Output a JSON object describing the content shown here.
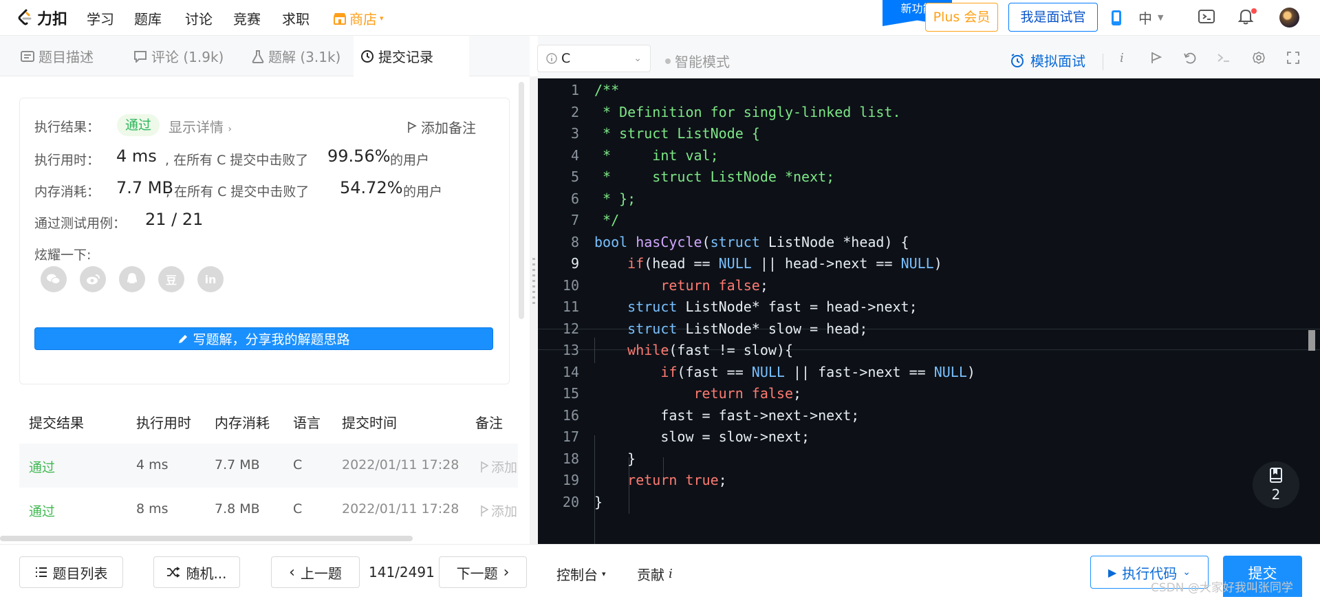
{
  "brand": {
    "name": "力扣"
  },
  "nav": {
    "learn": "学习",
    "problems": "题库",
    "discuss": "讨论",
    "contest": "竞赛",
    "jobs": "求职",
    "store": "商店",
    "new_feature": "新功能",
    "plus": "Plus 会员",
    "interviewer": "我是面试官",
    "language": "中"
  },
  "tabs": [
    {
      "label": "题目描述"
    },
    {
      "label": "评论 (1.9k)"
    },
    {
      "label": "题解 (3.1k)"
    },
    {
      "label": "提交记录"
    }
  ],
  "result": {
    "status_label": "执行结果：",
    "status": "通过",
    "show_detail": "显示详情",
    "add_note": "添加备注",
    "runtime_label": "执行用时：",
    "runtime": "4 ms",
    "runtime_mid": ", 在所有 C 提交中击败了",
    "runtime_pct": "99.56%",
    "runtime_suffix": "的用户",
    "memory_label": "内存消耗：",
    "memory": "7.7 MB",
    "memory_mid": ", 在所有 C 提交中击败了",
    "memory_pct": "54.72%",
    "memory_suffix": "的用户",
    "cases_label": "通过测试用例：",
    "cases": "21 / 21",
    "share_label": "炫耀一下:",
    "share_icons": [
      "wechat-icon",
      "weibo-icon",
      "qq-icon",
      "douban-icon",
      "linkedin-icon"
    ],
    "douban_glyph": "豆",
    "linkedin_glyph": "in",
    "write_solution": "写题解，分享我的解题思路"
  },
  "history": {
    "headers": [
      "提交结果",
      "执行用时",
      "内存消耗",
      "语言",
      "提交时间",
      "备注"
    ],
    "rows": [
      {
        "status": "通过",
        "runtime": "4 ms",
        "memory": "7.7 MB",
        "lang": "C",
        "time": "2022/01/11 17:28",
        "note": "添加"
      },
      {
        "status": "通过",
        "runtime": "8 ms",
        "memory": "7.8 MB",
        "lang": "C",
        "time": "2022/01/11 17:28",
        "note": "添加"
      }
    ]
  },
  "editor": {
    "language": "C",
    "smart_mode": "智能模式",
    "mock_interview": "模拟面试",
    "current_line": 9,
    "notes_count": "2",
    "line_numbers": [
      "1",
      "2",
      "3",
      "4",
      "5",
      "6",
      "7",
      "8",
      "9",
      "10",
      "11",
      "12",
      "13",
      "14",
      "15",
      "16",
      "17",
      "18",
      "19",
      "20"
    ],
    "lines": [
      "/**",
      " * Definition for singly-linked list.",
      " * struct ListNode {",
      " *     int val;",
      " *     struct ListNode *next;",
      " * };",
      " */",
      "bool hasCycle(struct ListNode *head) {",
      "    if(head == NULL || head->next == NULL)",
      "        return false;",
      "    struct ListNode* fast = head->next;",
      "    struct ListNode* slow = head;",
      "    while(fast != slow){",
      "        if(fast == NULL || fast->next == NULL)",
      "            return false;",
      "        fast = fast->next->next;",
      "        slow = slow->next;",
      "    }",
      "    return true;",
      "}"
    ]
  },
  "bottom": {
    "problem_list": "题目列表",
    "random": "随机...",
    "prev": "上一题",
    "page": "141/2491",
    "next": "下一题",
    "console": "控制台",
    "contribute": "贡献",
    "run_code": "执行代码",
    "submit": "提交"
  },
  "watermark": "CSDN @大家好我叫张同学",
  "colors": {
    "accent": "#1a90ff",
    "pass": "#3fb950",
    "store": "#ff9f1a",
    "editor_bg": "#0d1117"
  }
}
